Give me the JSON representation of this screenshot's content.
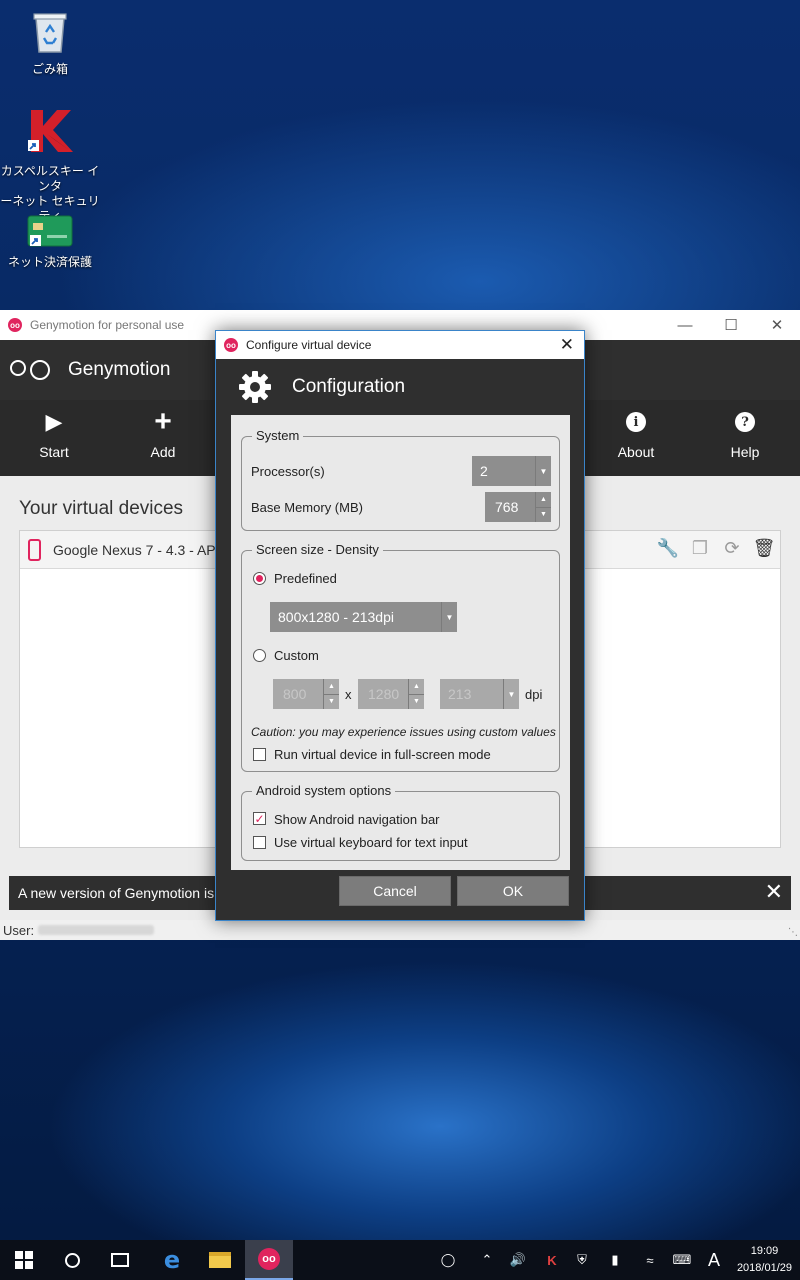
{
  "desktop": {
    "icons": [
      {
        "name": "recycle-bin",
        "label": "ごみ箱"
      },
      {
        "name": "kaspersky",
        "label_line1": "カスペルスキー インタ",
        "label_line2": "ーネット セキュリティ"
      },
      {
        "name": "safe-money",
        "label": "ネット決済保護"
      }
    ]
  },
  "main_window": {
    "title": "Genymotion for personal use",
    "brand": "Genymotion",
    "toolbar": {
      "start": "Start",
      "add": "Add",
      "about": "About",
      "help": "Help"
    },
    "section_title": "Your virtual devices",
    "device_name": "Google Nexus 7 - 4.3 - API 1",
    "notification": "A new version of Genymotion is av",
    "user_label": "User:"
  },
  "dialog": {
    "title": "Configure virtual device",
    "header": "Configuration",
    "system": {
      "title": "System",
      "processor_label": "Processor(s)",
      "processor_value": "2",
      "memory_label": "Base Memory (MB)",
      "memory_value": "768"
    },
    "screen": {
      "title": "Screen size - Density",
      "predefined_label": "Predefined",
      "predefined_value": "800x1280 - 213dpi",
      "custom_label": "Custom",
      "width": "800",
      "x_sep": "x",
      "height": "1280",
      "dpi_value": "213",
      "dpi_label": "dpi",
      "caution": "Caution: you may experience issues using custom values",
      "fullscreen_label": "Run virtual device in full-screen mode",
      "fullscreen_checked": false
    },
    "android": {
      "title": "Android system options",
      "navbar_label": "Show Android navigation bar",
      "navbar_checked": true,
      "keyboard_label": "Use virtual keyboard for text input",
      "keyboard_checked": false
    },
    "cancel": "Cancel",
    "ok": "OK"
  },
  "taskbar": {
    "ime": "A",
    "time": "19:09",
    "date": "2018/01/29"
  },
  "colors": {
    "accent": "#e0245e",
    "dark_bar": "#2f2f2f",
    "dialog_border": "#3a84c9"
  }
}
